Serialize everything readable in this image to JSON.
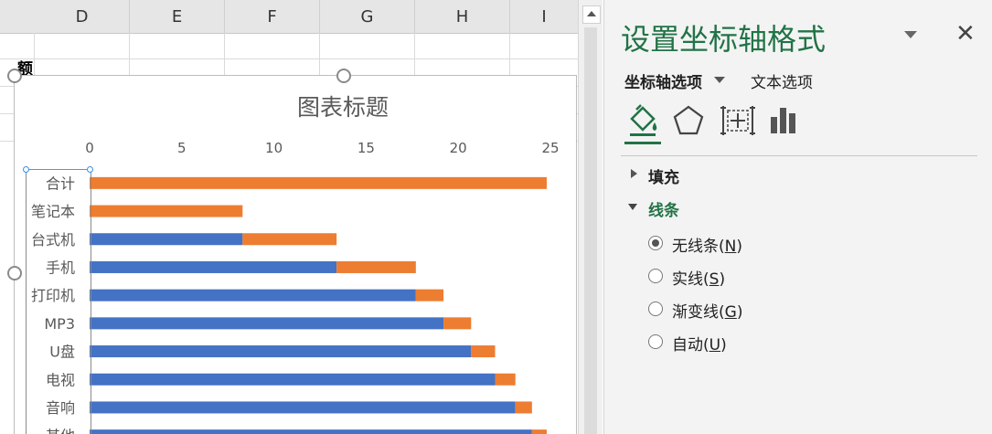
{
  "sheet": {
    "columns": [
      "D",
      "E",
      "F",
      "G",
      "H",
      "I"
    ],
    "partial_cell_text": "额"
  },
  "chart": {
    "title": "图表标题",
    "series_colors": {
      "base": "#4472c4",
      "increment": "#ed7d31"
    }
  },
  "chart_data": {
    "type": "bar",
    "stacked": true,
    "orientation": "horizontal",
    "title": "图表标题",
    "xaxis_position": "top",
    "xlim": [
      0,
      25
    ],
    "xticks": [
      0,
      5,
      10,
      15,
      20,
      25
    ],
    "categories": [
      "合计",
      "笔记本",
      "台式机",
      "手机",
      "打印机",
      "MP3",
      "U盘",
      "电视",
      "音响",
      "其他"
    ],
    "series": [
      {
        "color": "#4472c4",
        "values": [
          0,
          0,
          8.3,
          13.4,
          17.7,
          19.2,
          20.7,
          22.0,
          23.1,
          24.0
        ]
      },
      {
        "color": "#ed7d31",
        "values": [
          24.8,
          8.3,
          5.1,
          4.3,
          1.5,
          1.5,
          1.3,
          1.1,
          0.9,
          0.8
        ]
      }
    ],
    "grid": false,
    "legend": "none"
  },
  "panel": {
    "title": "设置坐标轴格式",
    "tab_axis": "坐标轴选项",
    "tab_text": "文本选项",
    "icons": [
      "fill-line-icon",
      "effects-icon",
      "size-properties-icon",
      "axis-options-icon"
    ],
    "section_fill": "填充",
    "section_line": "线条",
    "line_options": [
      {
        "label": "无线条",
        "key": "N",
        "selected": true
      },
      {
        "label": "实线",
        "key": "S",
        "selected": false
      },
      {
        "label": "渐变线",
        "key": "G",
        "selected": false
      },
      {
        "label": "自动",
        "key": "U",
        "selected": false
      }
    ],
    "accent": "#217346"
  }
}
